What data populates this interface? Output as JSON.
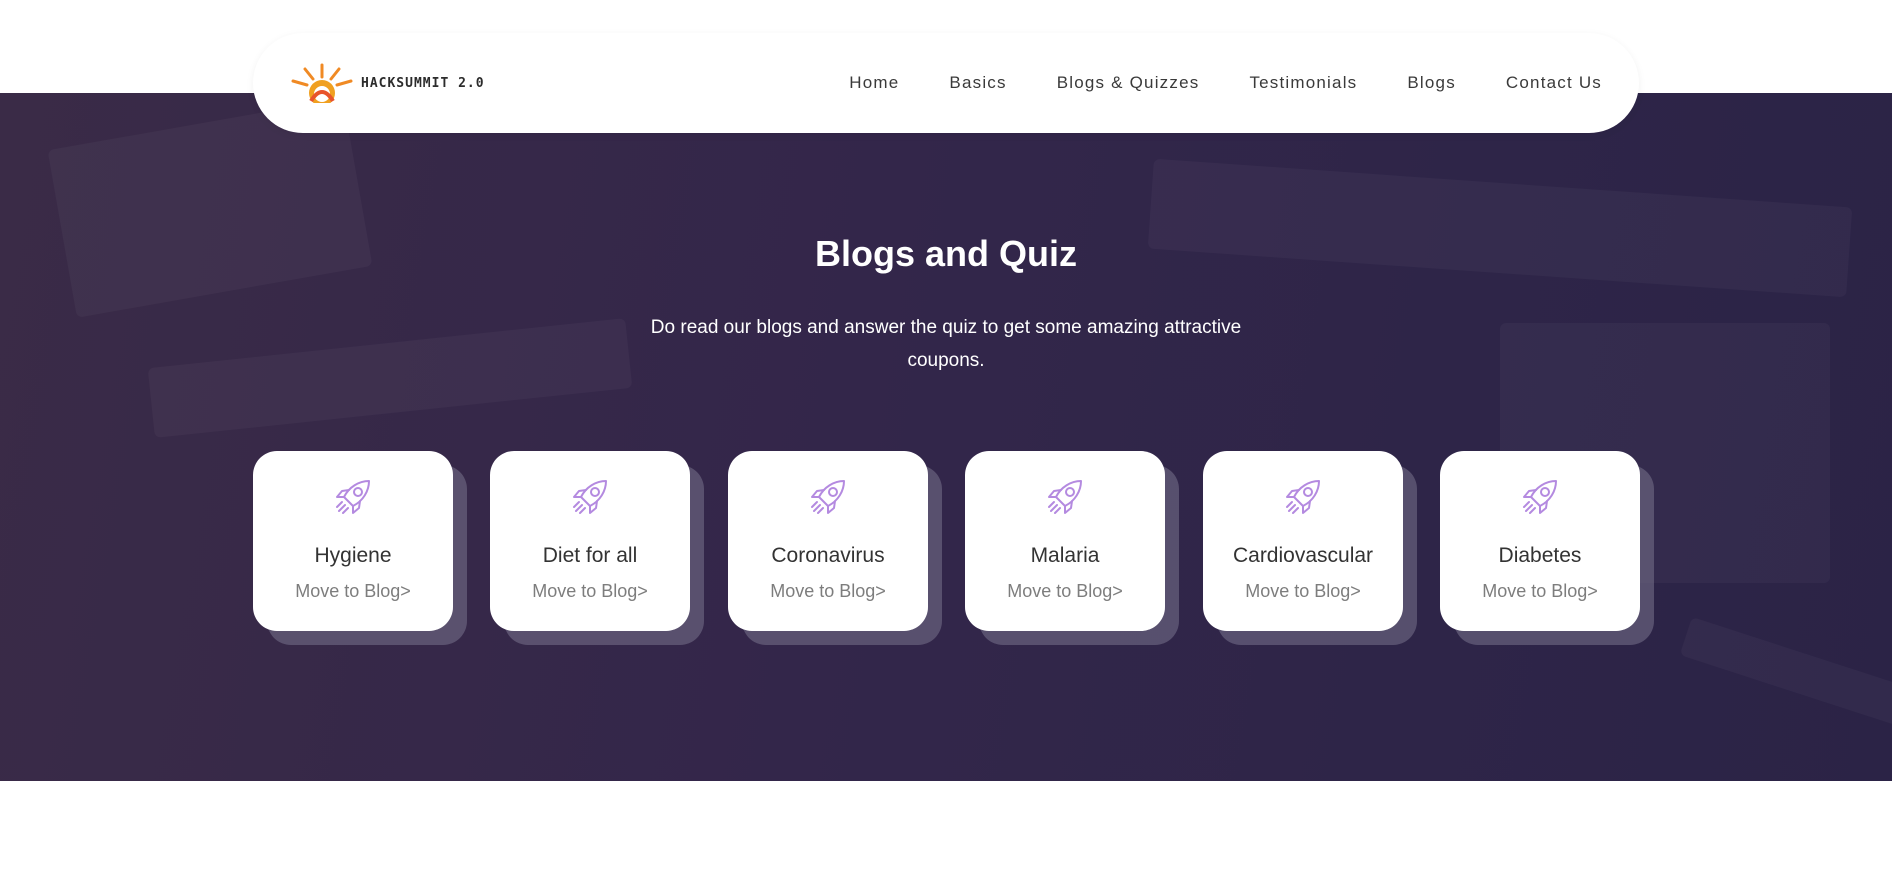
{
  "brand": {
    "name": "HACKSUMMIT 2.0",
    "icon": "sun-logo-icon",
    "colors": {
      "sun": "#f0a020",
      "ring": "#e8542b"
    }
  },
  "nav": {
    "items": [
      {
        "label": "Home"
      },
      {
        "label": "Basics"
      },
      {
        "label": "Blogs & Quizzes"
      },
      {
        "label": "Testimonials"
      },
      {
        "label": "Blogs"
      },
      {
        "label": "Contact Us"
      }
    ]
  },
  "hero": {
    "title": "Blogs and Quiz",
    "subtitle": "Do read our blogs and answer the quiz to get some amazing attractive coupons.",
    "background_color": "#33264a"
  },
  "cards": {
    "icon": "rocket-icon",
    "icon_color": "#b48ae0",
    "items": [
      {
        "title": "Hygiene",
        "link": "Move to Blog>"
      },
      {
        "title": "Diet for all",
        "link": "Move to Blog>"
      },
      {
        "title": "Coronavirus",
        "link": "Move to Blog>"
      },
      {
        "title": "Malaria",
        "link": "Move to Blog>"
      },
      {
        "title": "Cardiovascular",
        "link": "Move to Blog>"
      },
      {
        "title": "Diabetes",
        "link": "Move to Blog>"
      }
    ]
  }
}
